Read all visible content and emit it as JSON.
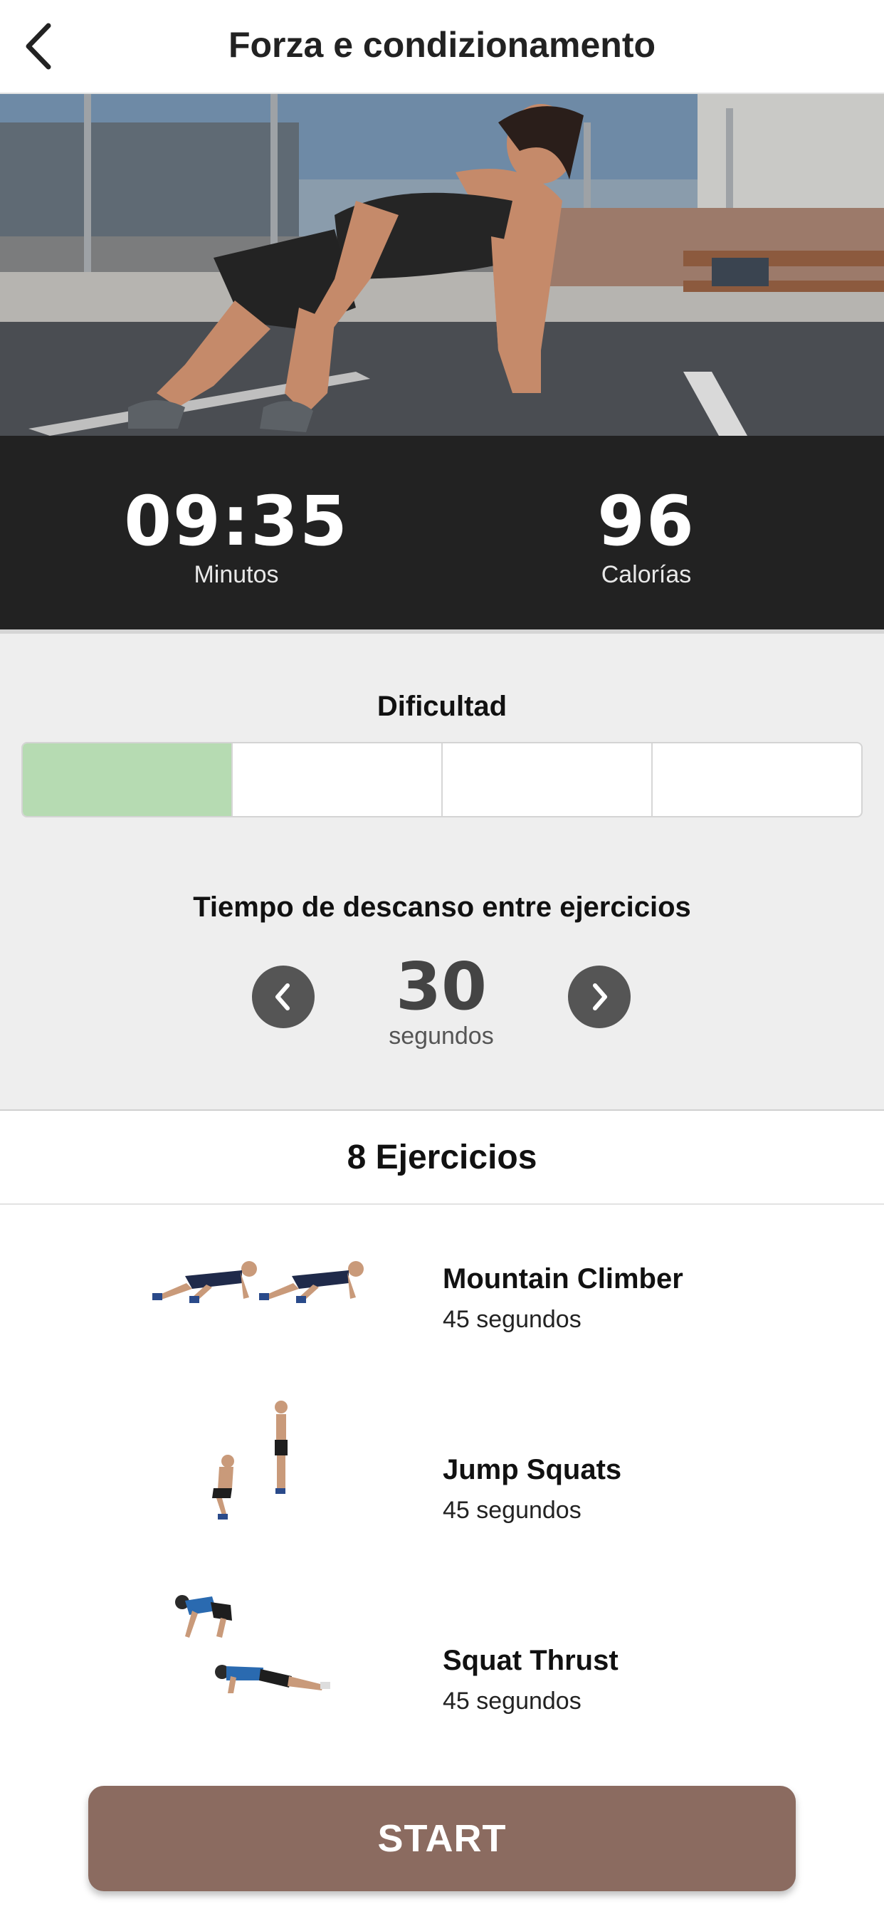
{
  "header": {
    "title": "Forza e condizionamento",
    "back_icon": "chevron-left-icon"
  },
  "stats": {
    "minutes_value": "09:35",
    "minutes_label": "Minutos",
    "calories_value": "96",
    "calories_label": "Calorías"
  },
  "difficulty": {
    "title": "Dificultad",
    "levels": 4,
    "selected": 1,
    "fill_color": "#b6dbb2"
  },
  "rest": {
    "title": "Tiempo de descanso entre ejercicios",
    "value": "30",
    "unit": "segundos",
    "prev_icon": "chevron-left-icon",
    "next_icon": "chevron-right-icon"
  },
  "exercises": {
    "header": "8 Ejercicios",
    "items": [
      {
        "name": "Mountain Climber",
        "duration": "45 segundos"
      },
      {
        "name": "Jump Squats",
        "duration": "45 segundos"
      },
      {
        "name": "Squat Thrust",
        "duration": "45 segundos"
      }
    ]
  },
  "start_button": {
    "label": "START",
    "color": "#8b6b60"
  }
}
